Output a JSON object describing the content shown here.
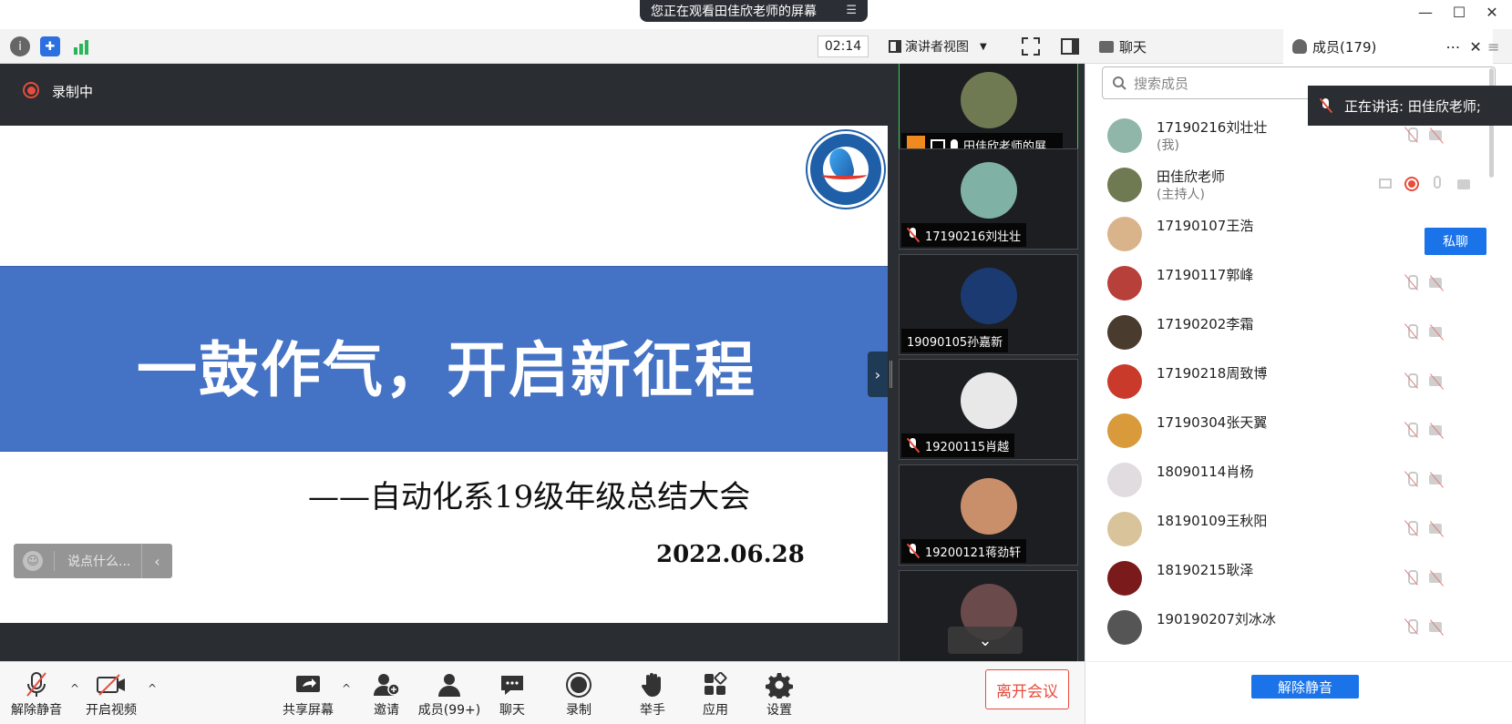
{
  "window": {
    "title": "您正在观看田佳欣老师的屏幕",
    "controls": [
      "minimize",
      "maximize",
      "close"
    ]
  },
  "toolbar": {
    "timer": "02:14",
    "view_mode": "演讲者视图",
    "icons": [
      "info-icon",
      "shield-icon",
      "signal-icon",
      "fullscreen-icon",
      "sidebar-toggle-icon"
    ]
  },
  "tabs": {
    "chat": "聊天",
    "members": "成员(179)"
  },
  "recording": {
    "label": "录制中"
  },
  "slide": {
    "title": "一鼓作气，开启新征程",
    "subtitle": "——自动化系19级年级总结大会",
    "date": "2022.06.28",
    "band_color": "#4472c4"
  },
  "chat_input": {
    "placeholder": "说点什么..."
  },
  "thumbnails": [
    {
      "name": "田佳欣老师的屏...",
      "color": "#6f7a52",
      "active": true
    },
    {
      "name": "17190216刘壮壮",
      "color": "#7fb2a4",
      "active": false
    },
    {
      "name": "19090105孙嘉新",
      "color": "#1b3a72",
      "active": false
    },
    {
      "name": "19200115肖越",
      "color": "#e8e8e8",
      "active": false
    },
    {
      "name": "19200121蒋劲轩",
      "color": "#c98f6a",
      "active": false
    }
  ],
  "members_panel": {
    "search_placeholder": "搜索成员",
    "speaking_label": "正在讲话: 田佳欣老师;",
    "private_chat": "私聊",
    "unmute_all": "解除静音",
    "items": [
      {
        "name": "17190216刘壮壮",
        "sub": "(我)",
        "color": "#8fb6a8"
      },
      {
        "name": "田佳欣老师",
        "sub": "(主持人)",
        "color": "#6f7a52"
      },
      {
        "name": "17190107王浩",
        "sub": "",
        "color": "#d9b48a"
      },
      {
        "name": "17190117郭峰",
        "sub": "",
        "color": "#b8403a"
      },
      {
        "name": "17190202李霜",
        "sub": "",
        "color": "#4a3b2f"
      },
      {
        "name": "17190218周致博",
        "sub": "",
        "color": "#c93a2a"
      },
      {
        "name": "17190304张天翼",
        "sub": "",
        "color": "#d89a3a"
      },
      {
        "name": "18090114肖杨",
        "sub": "",
        "color": "#e0dce0"
      },
      {
        "name": "18190109王秋阳",
        "sub": "",
        "color": "#d8c39a"
      },
      {
        "name": "18190215耿泽",
        "sub": "",
        "color": "#7a1a1a"
      },
      {
        "name": "190190207刘冰冰",
        "sub": "",
        "color": "#555555"
      }
    ]
  },
  "bottom_bar": {
    "unmute": "解除静音",
    "start_video": "开启视频",
    "share_screen": "共享屏幕",
    "invite": "邀请",
    "members": "成员(99+)",
    "chat": "聊天",
    "record": "录制",
    "raise_hand": "举手",
    "apps": "应用",
    "settings": "设置",
    "leave": "离开会议"
  }
}
